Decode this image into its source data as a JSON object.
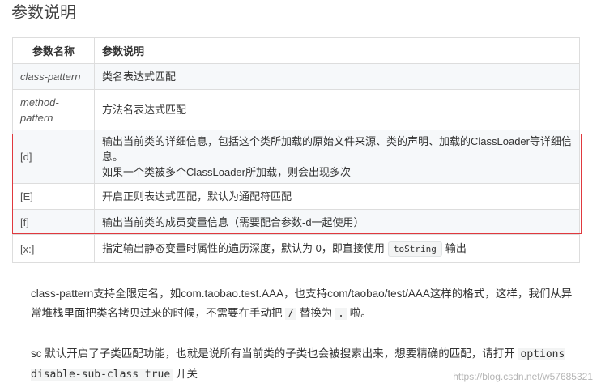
{
  "title": "参数说明",
  "table": {
    "headers": [
      "参数名称",
      "参数说明"
    ],
    "rows": [
      {
        "name": "class-pattern",
        "desc": "类名表达式匹配"
      },
      {
        "name": "method-\npattern",
        "desc": "方法名表达式匹配"
      },
      {
        "name": "[d]",
        "desc": "输出当前类的详细信息，包括这个类所加载的原始文件来源、类的声明、加载的ClassLoader等详细信息。",
        "desc2": "如果一个类被多个ClassLoader所加载，则会出现多次"
      },
      {
        "name": "[E]",
        "desc": "开启正则表达式匹配，默认为通配符匹配"
      },
      {
        "name": "[f]",
        "desc": "输出当前类的成员变量信息（需要配合参数-d一起使用）"
      },
      {
        "name": "[x:]",
        "desc_pre": "指定输出静态变量时属性的遍历深度，默认为 0，即直接使用",
        "desc_code": "toString",
        "desc_post": "输出"
      }
    ]
  },
  "para1": {
    "text": "class-pattern支持全限定名，如com.taobao.test.AAA，也支持com/taobao/test/AAA这样的格式，这样，我们从异常堆栈里面把类名拷贝过来的时候，不需要在手动把",
    "code1": "/",
    "mid": "替换为",
    "code2": ".",
    "end": "啦。"
  },
  "para2": {
    "text": "sc 默认开启了子类匹配功能，也就是说所有当前类的子类也会被搜索出来，想要精确的匹配，请打开",
    "code": "options disable-sub-class true",
    "end": "开关"
  },
  "watermark": "https://blog.csdn.net/w57685321",
  "colors": {
    "highlight_border": "#e0393e",
    "row_alt": "#f6f8fa",
    "border": "#dddddd"
  }
}
